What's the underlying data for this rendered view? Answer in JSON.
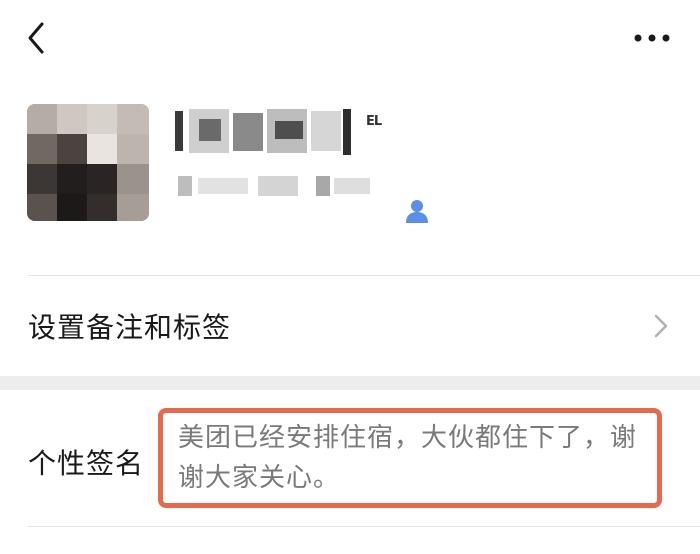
{
  "header": {
    "back_icon": "chevron-left-icon",
    "more_icon": "more-dots-icon"
  },
  "profile": {
    "name_suffix": "EL",
    "contact_icon": "person-icon",
    "colors": {
      "contact_icon": "#5b8ee6"
    }
  },
  "remark_row": {
    "label": "设置备注和标签",
    "chevron_icon": "chevron-right-icon"
  },
  "signature_row": {
    "label": "个性签名",
    "value": "美团已经安排住宿，大伙都住下了，谢谢大家关心。",
    "highlight_color": "#e46a4e"
  }
}
